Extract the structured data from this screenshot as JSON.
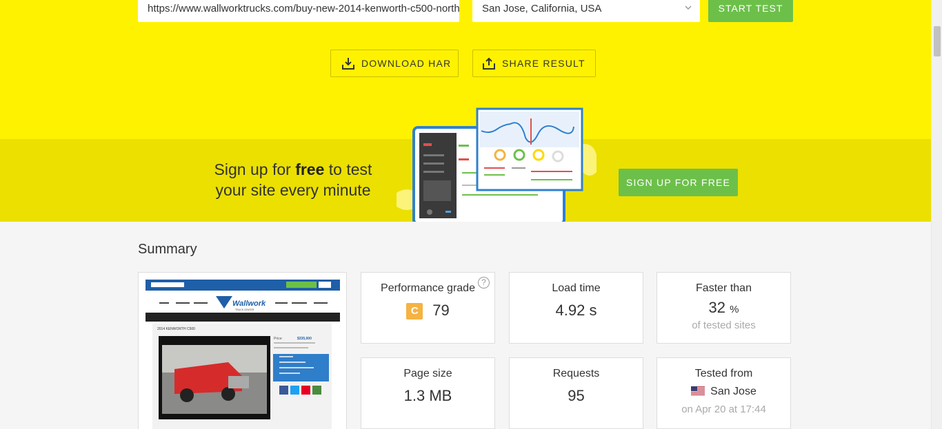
{
  "test_form": {
    "url_value": "https://www.wallworktrucks.com/buy-new-2014-kenworth-c500-north",
    "location": "San Jose, California, USA",
    "start_label": "START TEST"
  },
  "actions": {
    "download_label": "DOWNLOAD HAR",
    "share_label": "SHARE RESULT"
  },
  "promo": {
    "text_before": "Sign up for ",
    "text_bold": "free",
    "text_after": " to test",
    "line2": "your site every minute",
    "signup_label": "SIGN UP FOR FREE"
  },
  "summary": {
    "title": "Summary",
    "screenshot": {
      "logo": "Wallwork",
      "logo_sub": "TRUCK CENTER",
      "page_heading": "2014 KENWORTH C500",
      "price_label": "Price:",
      "price": "$335,000"
    },
    "performance": {
      "label": "Performance grade",
      "grade": "C",
      "score": "79",
      "help": "?"
    },
    "load_time": {
      "label": "Load time",
      "value": "4.92 s"
    },
    "faster_than": {
      "label": "Faster than",
      "value": "32",
      "unit": "%",
      "sub": "of tested sites"
    },
    "page_size": {
      "label": "Page size",
      "value": "1.3 MB"
    },
    "requests": {
      "label": "Requests",
      "value": "95"
    },
    "tested_from": {
      "label": "Tested from",
      "location": "San Jose",
      "date": "on Apr 20 at 17:44"
    }
  },
  "colors": {
    "brand_yellow": "#fff200",
    "band_yellow": "#ebe000",
    "accent_green": "#6cc04a",
    "grade_c": "#f5b342"
  }
}
